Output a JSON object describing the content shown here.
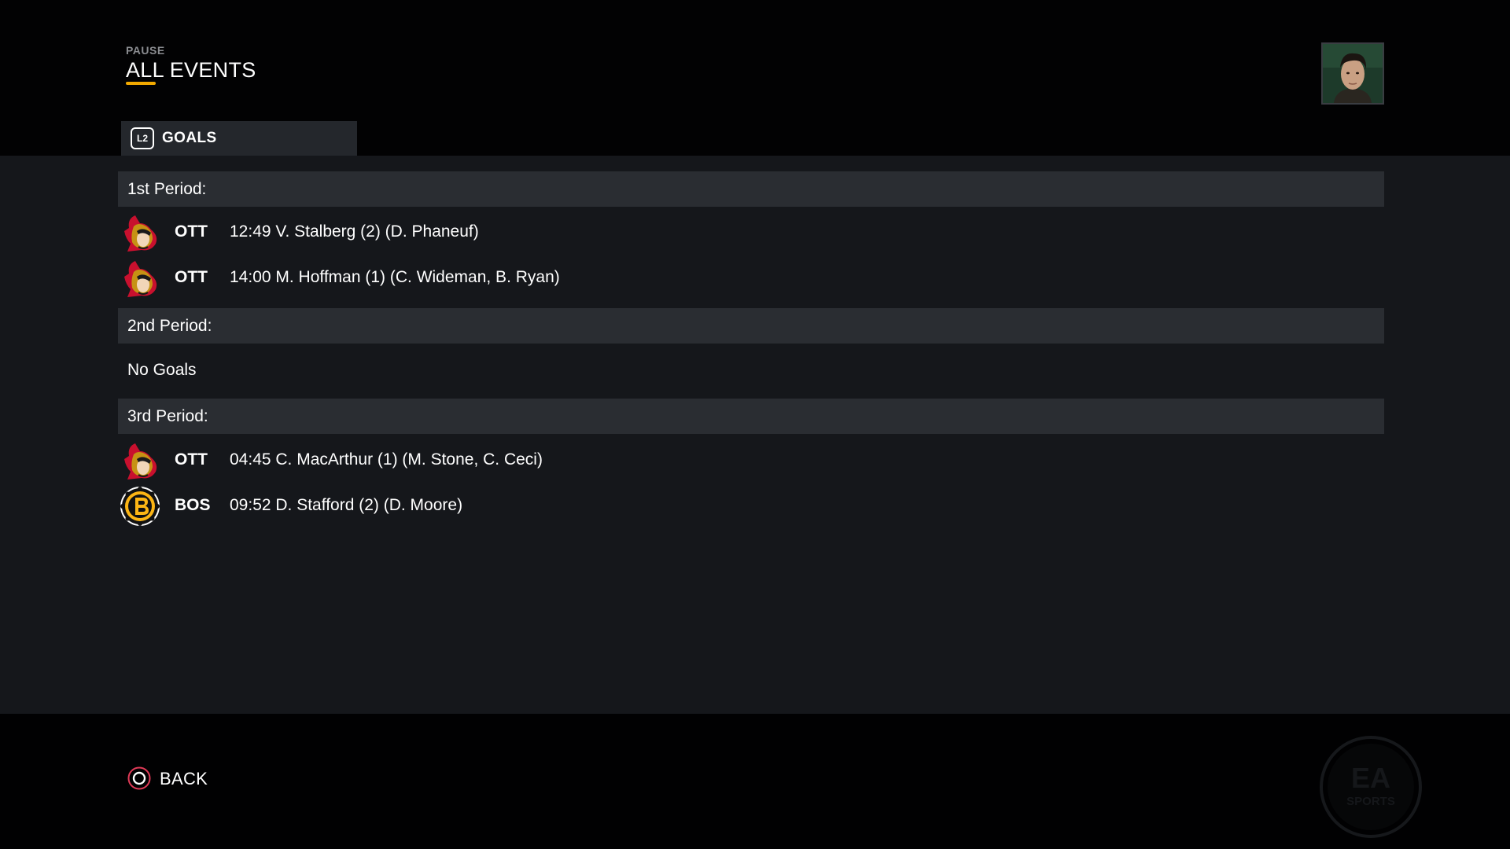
{
  "header": {
    "breadcrumb": "PAUSE",
    "title": "ALL EVENTS",
    "accent_color": "#f2a900"
  },
  "tab": {
    "button_badge": "L2",
    "label": "GOALS"
  },
  "periods": [
    {
      "label": "1st Period:",
      "goals": [
        {
          "team": "OTT",
          "team_logo_icon": "ottawa-senators-logo-icon",
          "description": "12:49 V. Stalberg (2) (D. Phaneuf)"
        },
        {
          "team": "OTT",
          "team_logo_icon": "ottawa-senators-logo-icon",
          "description": "14:00 M. Hoffman (1) (C. Wideman, B. Ryan)"
        }
      ]
    },
    {
      "label": "2nd Period:",
      "empty_text": "No Goals",
      "goals": []
    },
    {
      "label": "3rd Period:",
      "goals": [
        {
          "team": "OTT",
          "team_logo_icon": "ottawa-senators-logo-icon",
          "description": "04:45 C. MacArthur (1) (M. Stone, C. Ceci)"
        },
        {
          "team": "BOS",
          "team_logo_icon": "boston-bruins-logo-icon",
          "description": "09:52 D. Stafford (2) (D. Moore)"
        }
      ]
    }
  ],
  "footer": {
    "back_label": "BACK",
    "back_icon": "circle-button-icon",
    "watermark_icon": "ea-sports-logo-icon",
    "watermark_text_top": "EA",
    "watermark_text_bottom": "SPORTS"
  },
  "colors": {
    "ottawa_red": "#c8102e",
    "ottawa_gold": "#c69214",
    "boston_gold": "#fcb514",
    "back_icon_color": "#e03a57"
  }
}
